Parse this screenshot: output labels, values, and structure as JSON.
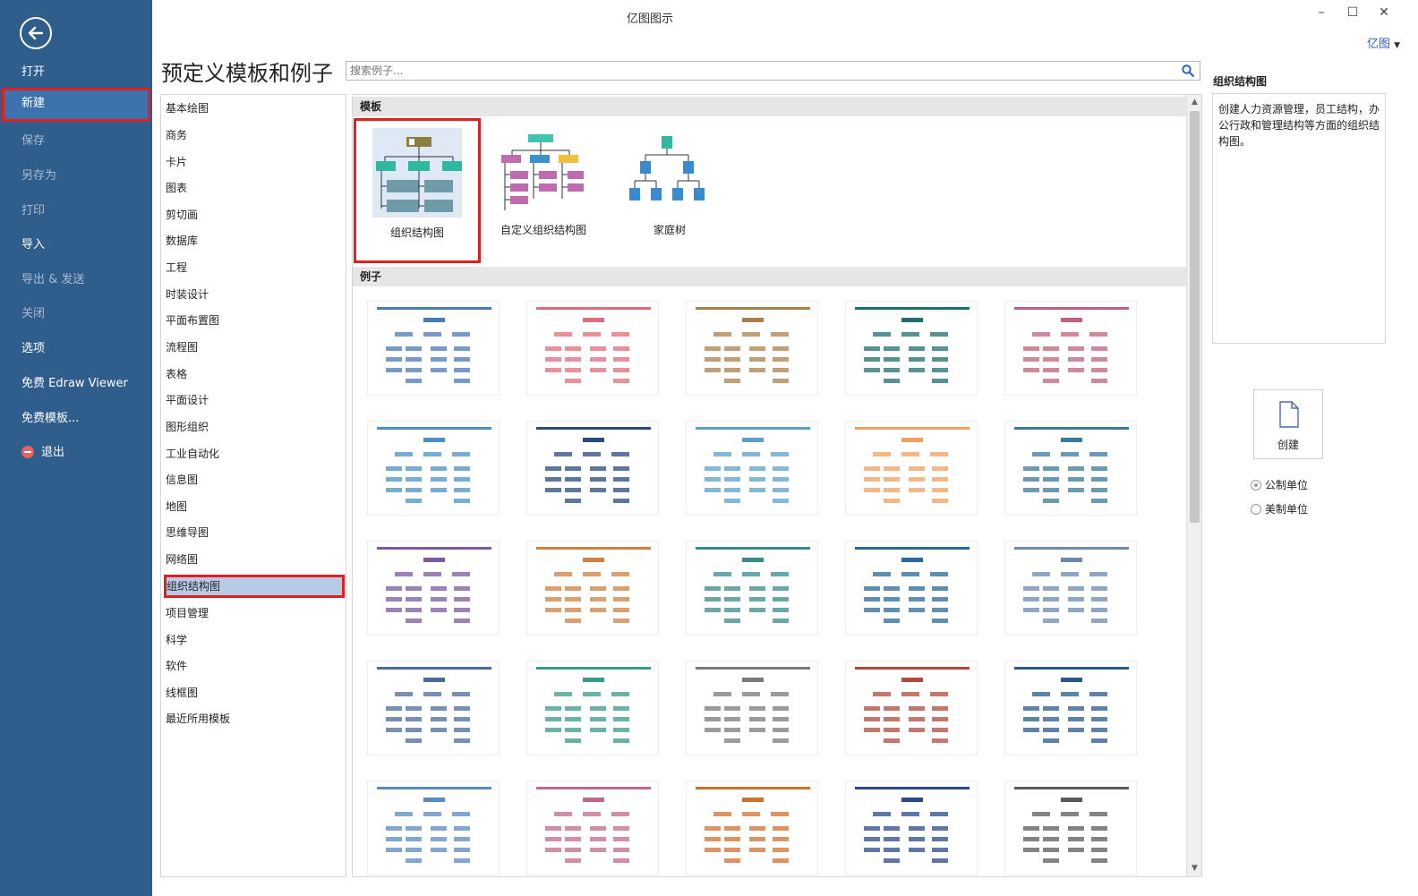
{
  "window": {
    "title": "亿图图示",
    "brand": "亿图"
  },
  "nav": {
    "items": [
      {
        "label": "打开",
        "state": "normal"
      },
      {
        "label": "新建",
        "state": "active"
      },
      {
        "label": "保存",
        "state": "dim"
      },
      {
        "label": "另存为",
        "state": "dim"
      },
      {
        "label": "打印",
        "state": "dim"
      },
      {
        "label": "导入",
        "state": "normal"
      },
      {
        "label": "导出 & 发送",
        "state": "dim"
      },
      {
        "label": "关闭",
        "state": "dim"
      },
      {
        "label": "选项",
        "state": "normal"
      },
      {
        "label": "免费 Edraw Viewer",
        "state": "normal"
      },
      {
        "label": "免费模板...",
        "state": "normal"
      },
      {
        "label": "退出",
        "state": "normal"
      }
    ]
  },
  "header": {
    "title": "预定义模板和例子"
  },
  "search": {
    "placeholder": "搜索例子..."
  },
  "categories": {
    "items": [
      "基本绘图",
      "商务",
      "卡片",
      "图表",
      "剪切画",
      "数据库",
      "工程",
      "时装设计",
      "平面布置图",
      "流程图",
      "表格",
      "平面设计",
      "图形组织",
      "工业自动化",
      "信息图",
      "地图",
      "思维导图",
      "网络图",
      "组织结构图",
      "项目管理",
      "科学",
      "软件",
      "线框图",
      "最近所用模板"
    ],
    "selected": "组织结构图"
  },
  "templates": {
    "header": "模板",
    "items": [
      {
        "label": "组织结构图",
        "selected": true
      },
      {
        "label": "自定义组织结构图",
        "selected": false
      },
      {
        "label": "家庭树",
        "selected": false
      }
    ]
  },
  "examples": {
    "header": "例子",
    "accents": [
      "#4a7ab5",
      "#e06c7a",
      "#a9804a",
      "#1f6f6f",
      "#c0607a",
      "#4a90c4",
      "#2a4a7a",
      "#5aa0c8",
      "#f0a060",
      "#3a7a9a",
      "#7a5aa0",
      "#d08040",
      "#3a8a8a",
      "#2a6a9a",
      "#6a8ab0",
      "#4a6a9a",
      "#3a9a8a",
      "#7a7a7a",
      "#b04a3a",
      "#2a5a8a",
      "#5a8ac0",
      "#c06a8a",
      "#d07030",
      "#2a4a8a",
      "#5a5a5a"
    ]
  },
  "right_panel": {
    "title": "组织结构图",
    "description": "创建人力资源管理，员工结构，办公行政和管理结构等方面的组织结构图。",
    "create_label": "创建",
    "units": [
      {
        "label": "公制单位",
        "checked": true
      },
      {
        "label": "美制单位",
        "checked": false
      }
    ]
  },
  "colors": {
    "nav_bg": "#2f5d8c",
    "highlight": "#e02020",
    "selected_bg": "#b8cbe6",
    "brand": "#2a62c9"
  }
}
